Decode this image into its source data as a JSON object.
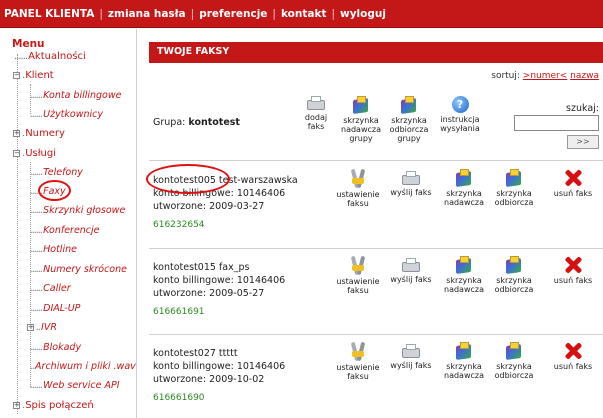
{
  "topnav": {
    "panel": "PANEL KLIENTA",
    "change_password": "zmiana hasła",
    "preferences": "preferencje",
    "contact": "kontakt",
    "logout": "wyloguj",
    "separator": "|"
  },
  "sidebar": {
    "title": "Menu",
    "items": {
      "aktualnosci": "Aktualności",
      "klient": "Klient",
      "konta_billingowe": "Konta billingowe",
      "uzytkownicy": "Użytkownicy",
      "numery": "Numery",
      "uslugi": "Usługi",
      "telefony": "Telefony",
      "faksy": "Faxy",
      "skrzynki": "Skrzynki głosowe",
      "konferencje": "Konferencje",
      "hotline": "Hotline",
      "numery_skrocone": "Numery skrócone",
      "caller": "Caller",
      "dialup": "DIAL-UP",
      "ivr": "IVR",
      "blokady": "Blokady",
      "archiwum": "Archiwum i pliki .wav",
      "webservice": "Web service API",
      "spis": "Spis połączeń"
    },
    "expand_symbol": "+",
    "collapse_symbol": "−",
    "dots": "......"
  },
  "main": {
    "header": "TWOJE FAKSY",
    "sort_label": "sortuj:",
    "sort_number": ">numer<",
    "sort_name": "nazwa",
    "group_label": "Grupa:",
    "group_name": "kontotest",
    "search_label": "szukaj:",
    "search_value": "",
    "search_button": ">>",
    "group_tools": {
      "add_fax": [
        "dodaj",
        "faks"
      ],
      "outbox": [
        "skrzynka",
        "nadawcza",
        "grupy"
      ],
      "inbox": [
        "skrzynka",
        "odbiorcza",
        "grupy"
      ],
      "help": [
        "instrukcja",
        "wysyłania"
      ],
      "help_glyph": "?"
    },
    "row_tools": {
      "settings": [
        "ustawienie",
        "faksu"
      ],
      "send": [
        "wyślij faks"
      ],
      "outbox": [
        "skrzynka",
        "nadawcza"
      ],
      "inbox": [
        "skrzynka",
        "odbiorcza"
      ],
      "delete": [
        "usuń faks"
      ]
    },
    "faxes": [
      {
        "name": "kontotest005 test-warszawska",
        "account": "konto billingowe: 10146406",
        "created": "utworzone: 2009-03-27",
        "number": "616232654"
      },
      {
        "name": "kontotest015 fax_ps",
        "account": "konto billingowe: 10146406",
        "created": "utworzone: 2009-05-27",
        "number": "616661691"
      },
      {
        "name": "kontotest027 ttttt",
        "account": "konto billingowe: 10146406",
        "created": "utworzone: 2009-10-02",
        "number": "616661690"
      }
    ]
  },
  "colors": {
    "brand": "#c41717",
    "number": "#2a8a1f",
    "highlight": "#e01010"
  },
  "icons": [
    "fax-icon",
    "outbox-icon",
    "inbox-icon",
    "help-icon",
    "settings-icon",
    "delete-icon"
  ]
}
